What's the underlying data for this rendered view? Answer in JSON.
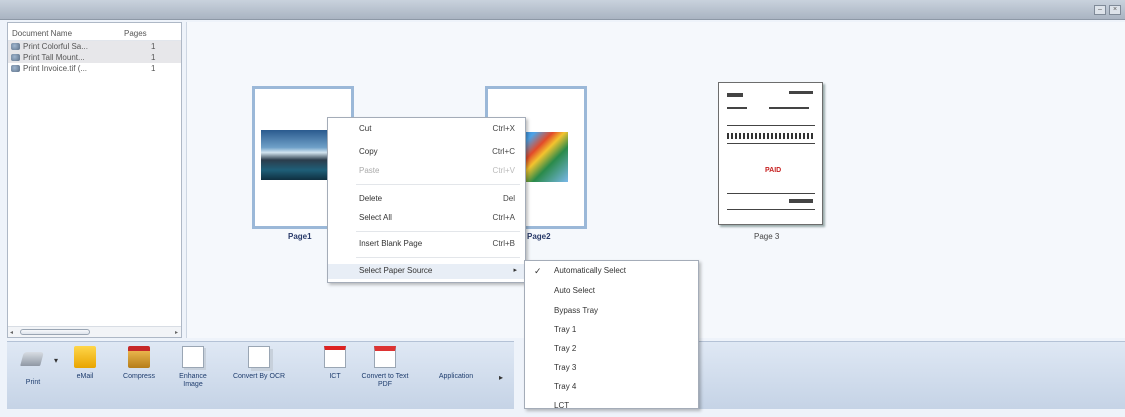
{
  "window": {
    "buttons": [
      "–",
      "×"
    ]
  },
  "document_list": {
    "headers": {
      "name": "Document Name",
      "pages": "Pages"
    },
    "rows": [
      {
        "name": "Print Colorful Sa...",
        "pages": "1"
      },
      {
        "name": "Print Tall Mount...",
        "pages": "1"
      },
      {
        "name": "Print Invoice.tif (...",
        "pages": "1"
      }
    ],
    "scroll_left": "◂",
    "scroll_right": "▸"
  },
  "pages": [
    {
      "label": "Page1"
    },
    {
      "label": "Page2"
    },
    {
      "label": "Page 3"
    }
  ],
  "invoice": {
    "red_stamp": "PAID"
  },
  "context_menu": {
    "items": [
      {
        "label": "Cut",
        "shortcut": "Ctrl+X"
      },
      {
        "label": "Copy",
        "shortcut": "Ctrl+C"
      },
      {
        "label": "Paste",
        "shortcut": "Ctrl+V"
      },
      {
        "label": "Delete",
        "shortcut": "Del"
      },
      {
        "label": "Select All",
        "shortcut": "Ctrl+A"
      },
      {
        "label": "Insert Blank Page",
        "shortcut": "Ctrl+B"
      },
      {
        "label": "Select Paper Source",
        "shortcut": "▸"
      }
    ]
  },
  "paper_source_menu": {
    "check": "✓",
    "items": [
      "Automatically Select",
      "Auto Select",
      "Bypass Tray",
      "Tray 1",
      "Tray 2",
      "Tray 3",
      "Tray 4",
      "LCT"
    ]
  },
  "toolbar": {
    "buttons": [
      {
        "label": "Print",
        "icon": "printer-icon"
      },
      {
        "label": "eMail",
        "icon": "email-icon"
      },
      {
        "label": "Compress",
        "icon": "compress-icon"
      },
      {
        "label": "Enhance Image",
        "icon": "enhance-image-icon"
      },
      {
        "label": "Convert By OCR",
        "icon": "ocr-icon"
      },
      {
        "label": "ICT",
        "icon": "ict-icon"
      },
      {
        "label": "Convert to Text PDF",
        "icon": "text-pdf-icon"
      },
      {
        "label": "Application",
        "icon": "application-icon"
      }
    ],
    "print_dropdown": "▾",
    "more": "▸"
  }
}
